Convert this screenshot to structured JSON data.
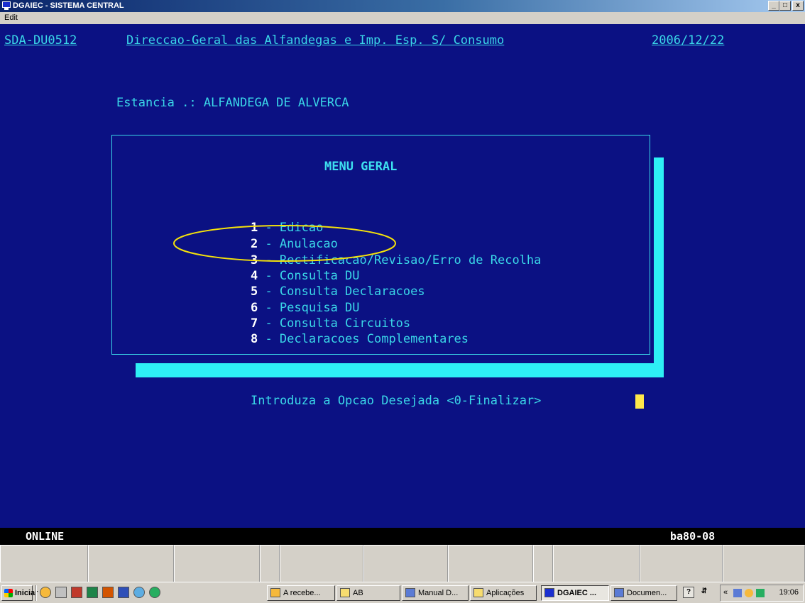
{
  "window": {
    "title": "DGAIEC - SISTEMA CENTRAL",
    "controls": [
      "_",
      "□",
      "x"
    ]
  },
  "menubar": {
    "edit": "Edit"
  },
  "header": {
    "screen_id": "SDA-DU0512",
    "title": "Direccao-Geral das Alfandegas e Imp. Esp. S/ Consumo",
    "date": "2006/12/22"
  },
  "estancia": "Estancia .: ALFANDEGA DE ALVERCA",
  "menu": {
    "title": "MENU GERAL",
    "items": [
      {
        "num": "1",
        "label": "Edicao"
      },
      {
        "num": "2",
        "label": "Anulacao"
      },
      {
        "num": "3",
        "label": "Rectificacao/Revisao/Erro de Recolha"
      },
      {
        "num": "4",
        "label": "Consulta DU"
      },
      {
        "num": "5",
        "label": "Consulta Declaracoes"
      },
      {
        "num": "6",
        "label": "Pesquisa DU"
      },
      {
        "num": "7",
        "label": "Consulta Circuitos"
      },
      {
        "num": "8",
        "label": "Declaracoes Complementares"
      }
    ]
  },
  "prompt": "Introduza a Opcao Desejada <0-Finalizar>",
  "status": {
    "left": "ONLINE",
    "right": "ba80-08"
  },
  "colors": {
    "terminal_bg": "#0b1183",
    "text": "#3ad7e8",
    "highlight_ellipse": "#f5e20a",
    "cursor": "#ffe84a"
  },
  "taskbar": {
    "start": "Iniciar",
    "tasks": [
      {
        "label": "A recebe...",
        "icon": "clock-icon"
      },
      {
        "label": "AB",
        "icon": "folder-icon"
      },
      {
        "label": "Manual D...",
        "icon": "word-icon"
      },
      {
        "label": "Aplicações",
        "icon": "folder-icon"
      },
      {
        "label": "DGAIEC ...",
        "icon": "terminal-icon",
        "active": true
      },
      {
        "label": "Documen...",
        "icon": "word-icon"
      }
    ],
    "clock": "19:06"
  }
}
